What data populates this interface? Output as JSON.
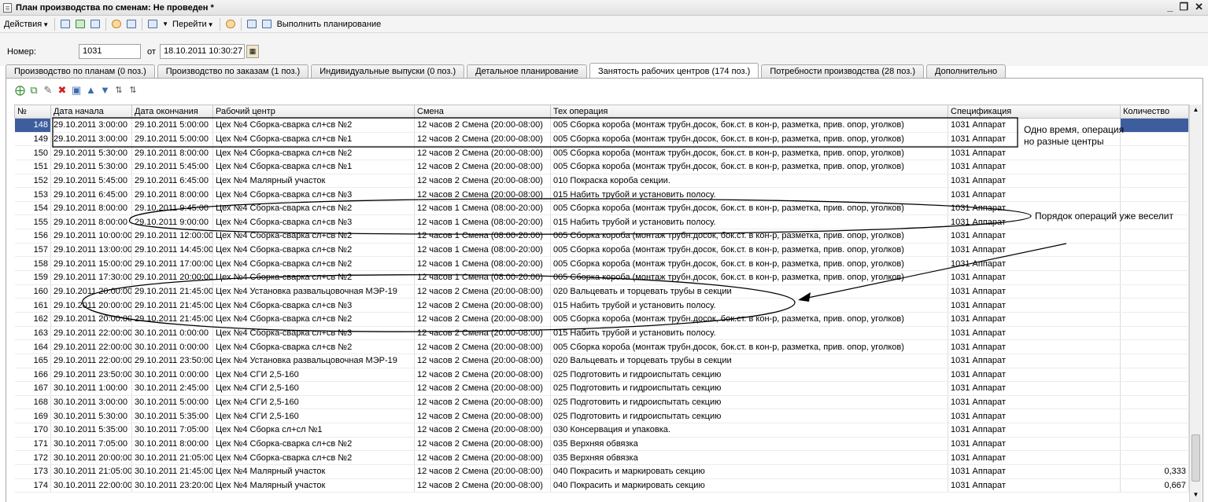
{
  "window": {
    "title": "План производства по сменам: Не проведен *"
  },
  "toolbar": {
    "actions_label": "Действия",
    "goto_label": "Перейти",
    "run_label": "Выполнить планирование"
  },
  "header": {
    "number_label": "Номер:",
    "number_value": "1031",
    "from_label": "от",
    "date_value": "18.10.2011 10:30:27"
  },
  "tabs": [
    "Производство по планам (0 поз.)",
    "Производство по заказам (1 поз.)",
    "Индивидуальные выпуски (0 поз.)",
    "Детальное планирование",
    "Занятость рабочих центров (174 поз.)",
    "Потребности производства (28 поз.)",
    "Дополнительно"
  ],
  "active_tab_index": 4,
  "columns": [
    "№",
    "Дата начала",
    "Дата окончания",
    "Рабочий центр",
    "Смена",
    "Тех операция",
    "Спецификация",
    "Количество"
  ],
  "rows": [
    [
      "148",
      "29.10.2011 3:00:00",
      "29.10.2011 5:00:00",
      "Цех №4 Сборка-сварка сл+св №2",
      "12 часов 2 Смена (20:00-08:00)",
      "005 Сборка короба (монтаж трубн.досок, бок.ст. в кон-р, разметка, прив. опор, уголков)",
      "1031 Аппарат",
      ""
    ],
    [
      "149",
      "29.10.2011 3:00:00",
      "29.10.2011 5:00:00",
      "Цех №4 Сборка-сварка сл+св №1",
      "12 часов 2 Смена (20:00-08:00)",
      "005 Сборка короба (монтаж трубн.досок, бок.ст. в кон-р, разметка, прив. опор, уголков)",
      "1031 Аппарат",
      ""
    ],
    [
      "150",
      "29.10.2011 5:30:00",
      "29.10.2011 8:00:00",
      "Цех №4 Сборка-сварка сл+св №2",
      "12 часов 2 Смена (20:00-08:00)",
      "005 Сборка короба (монтаж трубн.досок, бок.ст. в кон-р, разметка, прив. опор, уголков)",
      "1031 Аппарат",
      ""
    ],
    [
      "151",
      "29.10.2011 5:30:00",
      "29.10.2011 5:45:00",
      "Цех №4 Сборка-сварка сл+св №1",
      "12 часов 2 Смена (20:00-08:00)",
      "005 Сборка короба (монтаж трубн.досок, бок.ст. в кон-р, разметка, прив. опор, уголков)",
      "1031 Аппарат",
      ""
    ],
    [
      "152",
      "29.10.2011 5:45:00",
      "29.10.2011 6:45:00",
      "Цех №4 Малярный участок",
      "12 часов 2 Смена (20:00-08:00)",
      "010 Покраска короба секции.",
      "1031 Аппарат",
      ""
    ],
    [
      "153",
      "29.10.2011 6:45:00",
      "29.10.2011 8:00:00",
      "Цех №4 Сборка-сварка сл+св №3",
      "12 часов 2 Смена (20:00-08:00)",
      "015 Набить трубой и установить полосу.",
      "1031 Аппарат",
      ""
    ],
    [
      "154",
      "29.10.2011 8:00:00",
      "29.10.2011 9:45:00",
      "Цех №4 Сборка-сварка сл+св №2",
      "12 часов 1 Смена (08:00-20:00)",
      "005 Сборка короба (монтаж трубн.досок, бок.ст. в кон-р, разметка, прив. опор, уголков)",
      "1031 Аппарат",
      ""
    ],
    [
      "155",
      "29.10.2011 8:00:00",
      "29.10.2011 9:00:00",
      "Цех №4 Сборка-сварка сл+св №3",
      "12 часов 1 Смена (08:00-20:00)",
      "015 Набить трубой и установить полосу.",
      "1031 Аппарат",
      ""
    ],
    [
      "156",
      "29.10.2011 10:00:00",
      "29.10.2011 12:00:00",
      "Цех №4 Сборка-сварка сл+св №2",
      "12 часов 1 Смена (08:00-20:00)",
      "005 Сборка короба (монтаж трубн.досок, бок.ст. в кон-р, разметка, прив. опор, уголков)",
      "1031 Аппарат",
      ""
    ],
    [
      "157",
      "29.10.2011 13:00:00",
      "29.10.2011 14:45:00",
      "Цех №4 Сборка-сварка сл+св №2",
      "12 часов 1 Смена (08:00-20:00)",
      "005 Сборка короба (монтаж трубн.досок, бок.ст. в кон-р, разметка, прив. опор, уголков)",
      "1031 Аппарат",
      ""
    ],
    [
      "158",
      "29.10.2011 15:00:00",
      "29.10.2011 17:00:00",
      "Цех №4 Сборка-сварка сл+св №2",
      "12 часов 1 Смена (08:00-20:00)",
      "005 Сборка короба (монтаж трубн.досок, бок.ст. в кон-р, разметка, прив. опор, уголков)",
      "1031 Аппарат",
      ""
    ],
    [
      "159",
      "29.10.2011 17:30:00",
      "29.10.2011 20:00:00",
      "Цех №4 Сборка-сварка сл+св №2",
      "12 часов 1 Смена (08:00-20:00)",
      "005 Сборка короба (монтаж трубн.досок, бок.ст. в кон-р, разметка, прив. опор, уголков)",
      "1031 Аппарат",
      ""
    ],
    [
      "160",
      "29.10.2011 20:00:00",
      "29.10.2011 21:45:00",
      "Цех №4 Установка развальцовочная МЭР-19",
      "12 часов 2 Смена (20:00-08:00)",
      "020 Вальцевать и торцевать трубы в секции",
      "1031 Аппарат",
      ""
    ],
    [
      "161",
      "29.10.2011 20:00:00",
      "29.10.2011 21:45:00",
      "Цех №4 Сборка-сварка сл+св №3",
      "12 часов 2 Смена (20:00-08:00)",
      "015 Набить трубой и установить полосу.",
      "1031 Аппарат",
      ""
    ],
    [
      "162",
      "29.10.2011 20:00:00",
      "29.10.2011 21:45:00",
      "Цех №4 Сборка-сварка сл+св №2",
      "12 часов 2 Смена (20:00-08:00)",
      "005 Сборка короба (монтаж трубн.досок, бок.ст. в кон-р, разметка, прив. опор, уголков)",
      "1031 Аппарат",
      ""
    ],
    [
      "163",
      "29.10.2011 22:00:00",
      "30.10.2011 0:00:00",
      "Цех №4 Сборка-сварка сл+св №3",
      "12 часов 2 Смена (20:00-08:00)",
      "015 Набить трубой и установить полосу.",
      "1031 Аппарат",
      ""
    ],
    [
      "164",
      "29.10.2011 22:00:00",
      "30.10.2011 0:00:00",
      "Цех №4 Сборка-сварка сл+св №2",
      "12 часов 2 Смена (20:00-08:00)",
      "005 Сборка короба (монтаж трубн.досок, бок.ст. в кон-р, разметка, прив. опор, уголков)",
      "1031 Аппарат",
      ""
    ],
    [
      "165",
      "29.10.2011 22:00:00",
      "29.10.2011 23:50:00",
      "Цех №4 Установка развальцовочная МЭР-19",
      "12 часов 2 Смена (20:00-08:00)",
      "020 Вальцевать и торцевать трубы в секции",
      "1031 Аппарат",
      ""
    ],
    [
      "166",
      "29.10.2011 23:50:00",
      "30.10.2011 0:00:00",
      "Цех №4 СГИ 2,5-160",
      "12 часов 2 Смена (20:00-08:00)",
      "025 Подготовить и гидроиспытать секцию",
      "1031 Аппарат",
      ""
    ],
    [
      "167",
      "30.10.2011 1:00:00",
      "30.10.2011 2:45:00",
      "Цех №4 СГИ 2,5-160",
      "12 часов 2 Смена (20:00-08:00)",
      "025 Подготовить и гидроиспытать секцию",
      "1031 Аппарат",
      ""
    ],
    [
      "168",
      "30.10.2011 3:00:00",
      "30.10.2011 5:00:00",
      "Цех №4 СГИ 2,5-160",
      "12 часов 2 Смена (20:00-08:00)",
      "025 Подготовить и гидроиспытать секцию",
      "1031 Аппарат",
      ""
    ],
    [
      "169",
      "30.10.2011 5:30:00",
      "30.10.2011 5:35:00",
      "Цех №4 СГИ 2,5-160",
      "12 часов 2 Смена (20:00-08:00)",
      "025 Подготовить и гидроиспытать секцию",
      "1031 Аппарат",
      ""
    ],
    [
      "170",
      "30.10.2011 5:35:00",
      "30.10.2011 7:05:00",
      "Цех №4 Сборка сл+сл №1",
      "12 часов 2 Смена (20:00-08:00)",
      "030 Консервация и упаковка.",
      "1031 Аппарат",
      ""
    ],
    [
      "171",
      "30.10.2011 7:05:00",
      "30.10.2011 8:00:00",
      "Цех №4 Сборка-сварка сл+св №2",
      "12 часов 2 Смена (20:00-08:00)",
      "035 Верхняя обвязка",
      "1031 Аппарат",
      ""
    ],
    [
      "172",
      "30.10.2011 20:00:00",
      "30.10.2011 21:05:00",
      "Цех №4 Сборка-сварка сл+св №2",
      "12 часов 2 Смена (20:00-08:00)",
      "035 Верхняя обвязка",
      "1031 Аппарат",
      ""
    ],
    [
      "173",
      "30.10.2011 21:05:00",
      "30.10.2011 21:45:00",
      "Цех №4 Малярный участок",
      "12 часов 2 Смена (20:00-08:00)",
      "040 Покрасить и маркировать секцию",
      "1031 Аппарат",
      "0,333"
    ],
    [
      "174",
      "30.10.2011 22:00:00",
      "30.10.2011 23:20:00",
      "Цех №4 Малярный участок",
      "12 часов 2 Смена (20:00-08:00)",
      "040 Покрасить и маркировать секцию",
      "1031 Аппарат",
      "0,667"
    ]
  ],
  "annotations": {
    "note1_line1": "Одно время, операция",
    "note1_line2": "но разные центры",
    "note2": "Порядок операций уже веселит"
  }
}
